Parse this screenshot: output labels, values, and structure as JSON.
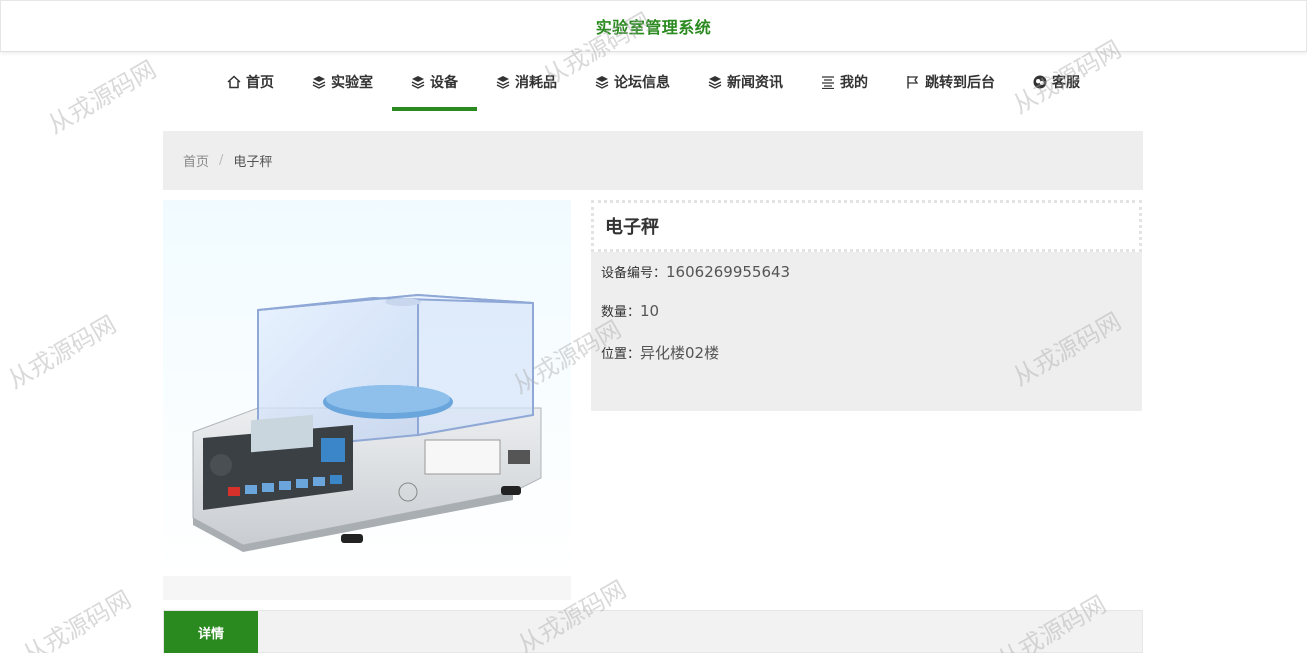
{
  "header": {
    "title": "实验室管理系统"
  },
  "nav": {
    "items": [
      {
        "label": "首页"
      },
      {
        "label": "实验室"
      },
      {
        "label": "设备"
      },
      {
        "label": "消耗品"
      },
      {
        "label": "论坛信息"
      },
      {
        "label": "新闻资讯"
      },
      {
        "label": "我的"
      },
      {
        "label": "跳转到后台"
      },
      {
        "label": "客服"
      }
    ],
    "active": "设备"
  },
  "breadcrumb": {
    "home": "首页",
    "separator": "/",
    "current": "电子秤"
  },
  "product": {
    "name": "电子秤",
    "code_label": "设备编号：",
    "code": "1606269955643",
    "qty_label": "数量：",
    "qty": "10",
    "location_label": "位置：",
    "location": "异化楼02楼"
  },
  "tabs": {
    "detail": "详情"
  },
  "watermark": {
    "text": "从戎源码网"
  },
  "colors": {
    "accent": "#2a8a1f",
    "panel": "#eeeeee"
  }
}
